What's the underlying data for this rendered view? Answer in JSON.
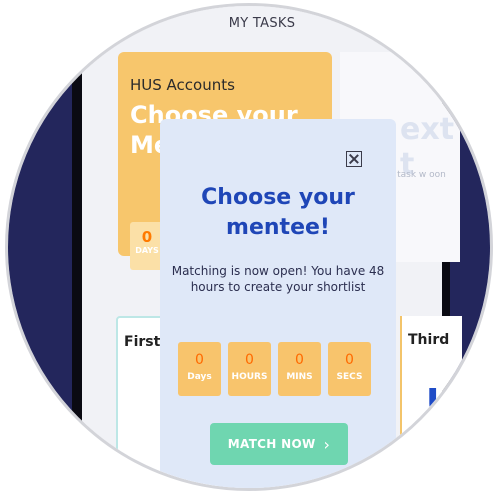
{
  "header": {
    "title": "MY TASKS"
  },
  "accounts_card": {
    "title": "HUS Accounts",
    "headline_partial": "Choose your Me",
    "mini_timer": {
      "value": "0",
      "label": "DAYS"
    }
  },
  "right_card": {
    "big_text": "ext t",
    "sub_text": "ext task w oon"
  },
  "bottom_cards": {
    "first_title": "First",
    "third_title": "Third",
    "third_big": "U"
  },
  "modal": {
    "heading": "Choose your mentee!",
    "description": "Matching is now open! You have 48 hours to create your shortlist",
    "timer": [
      {
        "value": "0",
        "label": "Days"
      },
      {
        "value": "0",
        "label": "HOURS"
      },
      {
        "value": "0",
        "label": "MINS"
      },
      {
        "value": "0",
        "label": "SECS"
      }
    ],
    "button_label": "MATCH NOW",
    "button_icon": "chevron-right-icon"
  },
  "colors": {
    "navy": "#23265c",
    "orange_card": "#f7c66c",
    "modal_bg": "#dfe8f8",
    "heading_blue": "#1f46b7",
    "timer_number": "#ff6a00",
    "button_green": "#6fd6b0"
  }
}
